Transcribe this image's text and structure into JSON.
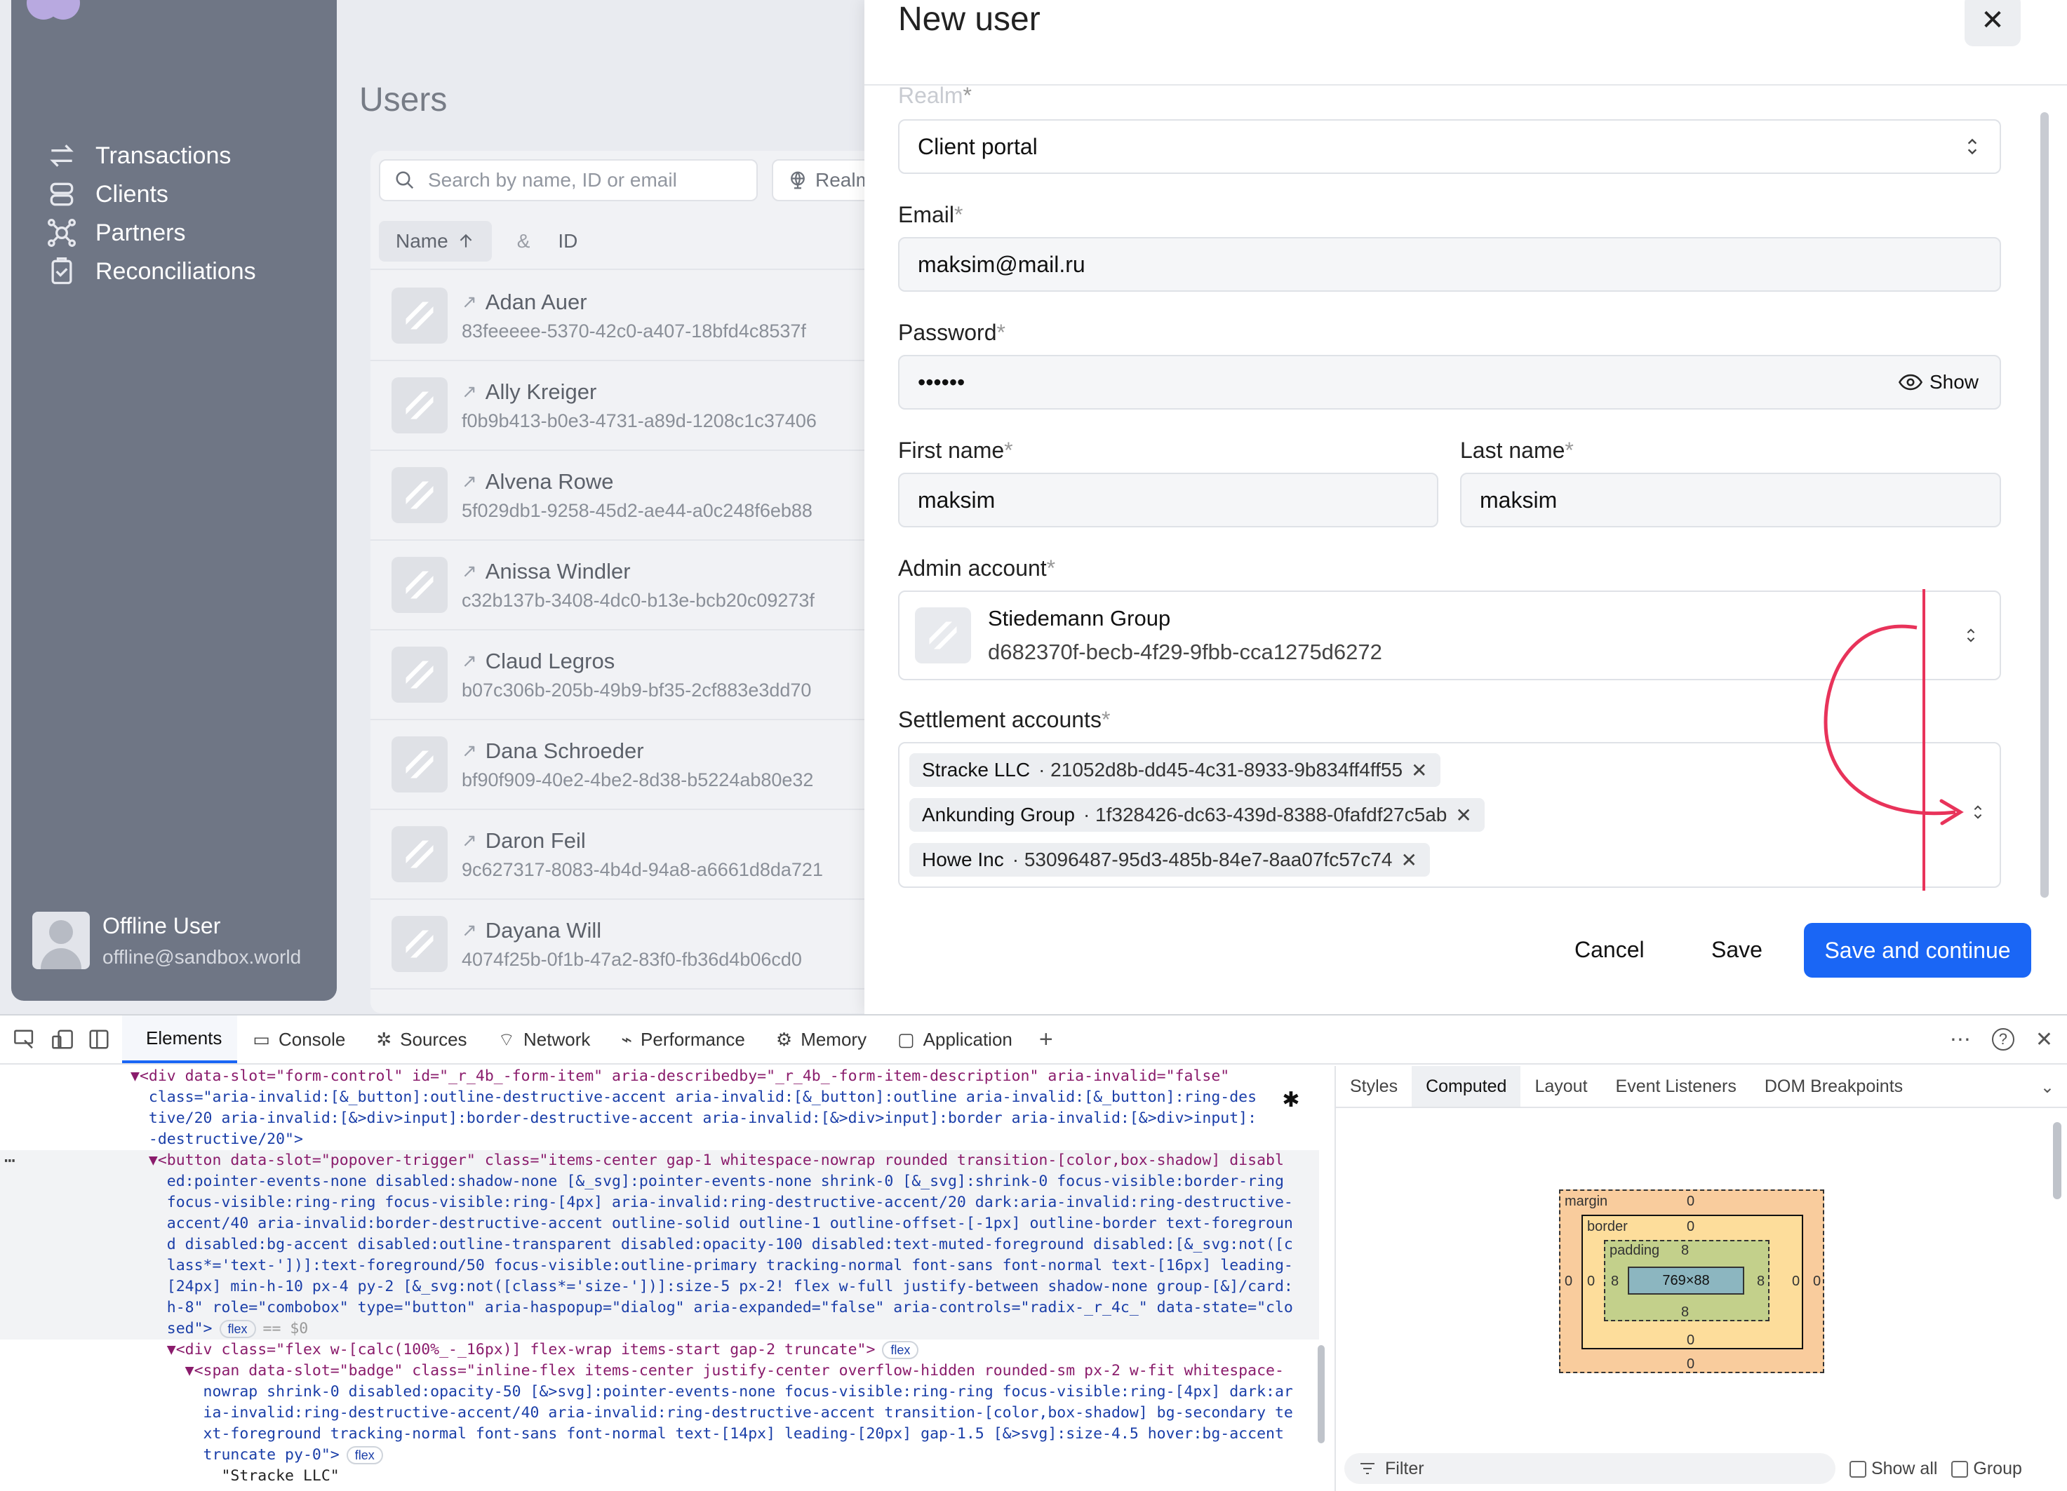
{
  "sidebar": {
    "nav": [
      {
        "label": "Transactions",
        "icon": "arrows-swap-icon"
      },
      {
        "label": "Clients",
        "icon": "database-icon"
      },
      {
        "label": "Partners",
        "icon": "network-icon"
      },
      {
        "label": "Reconciliations",
        "icon": "clipboard-check-icon"
      }
    ],
    "user": {
      "name": "Offline User",
      "email": "offline@sandbox.world"
    }
  },
  "users_page": {
    "title": "Users",
    "search_placeholder": "Search by name, ID or email",
    "realm_filter": "Realm",
    "columns": {
      "name": "Name",
      "sep": "&",
      "id": "ID"
    },
    "rows": [
      {
        "name": "Adan Auer",
        "id": "83feeeee-5370-42c0-a407-18bfd4c8537f"
      },
      {
        "name": "Ally Kreiger",
        "id": "f0b9b413-b0e3-4731-a89d-1208c1c37406"
      },
      {
        "name": "Alvena Rowe",
        "id": "5f029db1-9258-45d2-ae44-a0c248f6eb88"
      },
      {
        "name": "Anissa Windler",
        "id": "c32b137b-3408-4dc0-b13e-bcb20c09273f"
      },
      {
        "name": "Claud Legros",
        "id": "b07c306b-205b-49b9-bf35-2cf883e3dd70"
      },
      {
        "name": "Dana Schroeder",
        "id": "bf90f909-40e2-4be2-8d38-b5224ab80e32"
      },
      {
        "name": "Daron Feil",
        "id": "9c627317-8083-4b4d-94a8-a6661d8da721"
      },
      {
        "name": "Dayana Will",
        "id": "4074f25b-0f1b-47a2-83f0-fb36d4b06cd0"
      }
    ]
  },
  "modal": {
    "title": "New user",
    "close": "✕",
    "realm_label": "Realm",
    "realm_value": "Client portal",
    "email_label": "Email",
    "email_value": "maksim@mail.ru",
    "password_label": "Password",
    "password_value": "••••••",
    "show_label": "Show",
    "first_name_label": "First name",
    "first_name_value": "maksim",
    "last_name_label": "Last name",
    "last_name_value": "maksim",
    "admin_label": "Admin account",
    "admin_name": "Stiedemann Group",
    "admin_id": "d682370f-becb-4f29-9fbb-cca1275d6272",
    "settlement_label": "Settlement accounts",
    "settlements": [
      {
        "name": "Stracke LLC",
        "id": "· 21052d8b-dd45-4c31-8933-9b834ff4ff55"
      },
      {
        "name": "Ankunding Group",
        "id": "· 1f328426-dc63-439d-8388-0fafdf27c5ab"
      },
      {
        "name": "Howe Inc",
        "id": "· 53096487-95d3-485b-84e7-8aa07fc57c74"
      }
    ],
    "required": "*",
    "cancel": "Cancel",
    "save": "Save",
    "save_continue": "Save and continue"
  },
  "devtools": {
    "tabs": [
      "Elements",
      "Console",
      "Sources",
      "Network",
      "Performance",
      "Memory",
      "Application"
    ],
    "right_tabs": [
      "Styles",
      "Computed",
      "Layout",
      "Event Listeners",
      "DOM Breakpoints"
    ],
    "box_model": {
      "margin": "margin",
      "border": "border",
      "padding": "padding",
      "content": "769×88",
      "zero": "0",
      "eight": "8"
    },
    "filter_placeholder": "Filter",
    "show_all": "Show all",
    "group": "Group",
    "code_lines": [
      "▼<div data-slot=\"form-control\" id=\"_r_4b_-form-item\" aria-describedby=\"_r_4b_-form-item-description\" aria-invalid=\"false\"",
      "  class=\"aria-invalid:[&_button]:outline-destructive-accent aria-invalid:[&_button]:outline aria-invalid:[&_button]:ring-des",
      "  tive/20 aria-invalid:[&>div>input]:border-destructive-accent aria-invalid:[&>div>input]:border aria-invalid:[&>div>input]:",
      "  -destructive/20\">",
      "  ▼<button data-slot=\"popover-trigger\" class=\"items-center gap-1 whitespace-nowrap rounded transition-[color,box-shadow] disabl",
      "    ed:pointer-events-none disabled:shadow-none [&_svg]:pointer-events-none shrink-0 [&_svg]:shrink-0 focus-visible:border-ring",
      "    focus-visible:ring-ring focus-visible:ring-[4px] aria-invalid:ring-destructive-accent/20 dark:aria-invalid:ring-destructive-",
      "    accent/40 aria-invalid:border-destructive-accent outline-solid outline-1 outline-offset-[-1px] outline-border text-foregroun",
      "    d disabled:bg-accent disabled:outline-transparent disabled:opacity-100 disabled:text-muted-foreground disabled:[&_svg:not([c",
      "    lass*='text-'])]:text-foreground/50 focus-visible:outline-primary tracking-normal font-sans font-normal text-[16px] leading-",
      "    [24px] min-h-10 px-4 py-2 [&_svg:not([class*='size-'])]:size-5 px-2! flex w-full justify-between shadow-none group-[&]/card:",
      "    h-8\" role=\"combobox\" type=\"button\" aria-haspopup=\"dialog\" aria-expanded=\"false\" aria-controls=\"radix-_r_4c_\" data-state=\"clo",
      "    sed\">",
      "    ▼<div class=\"flex w-[calc(100%_-_16px)] flex-wrap items-start gap-2 truncate\">",
      "      ▼<span data-slot=\"badge\" class=\"inline-flex items-center justify-center overflow-hidden rounded-sm px-2 w-fit whitespace-",
      "        nowrap shrink-0 disabled:opacity-50 [&>svg]:pointer-events-none focus-visible:ring-ring focus-visible:ring-[4px] dark:ar",
      "        ia-invalid:ring-destructive-accent/40 aria-invalid:ring-destructive-accent transition-[color,box-shadow] bg-secondary te",
      "        xt-foreground tracking-normal font-sans font-normal text-[14px] leading-[20px] gap-1.5 [&>svg]:size-4.5 hover:bg-accent",
      "        truncate py-0\">",
      "          \"Stracke LLC\""
    ],
    "pills": {
      "flex": "flex",
      "dollar": "== $0"
    }
  }
}
